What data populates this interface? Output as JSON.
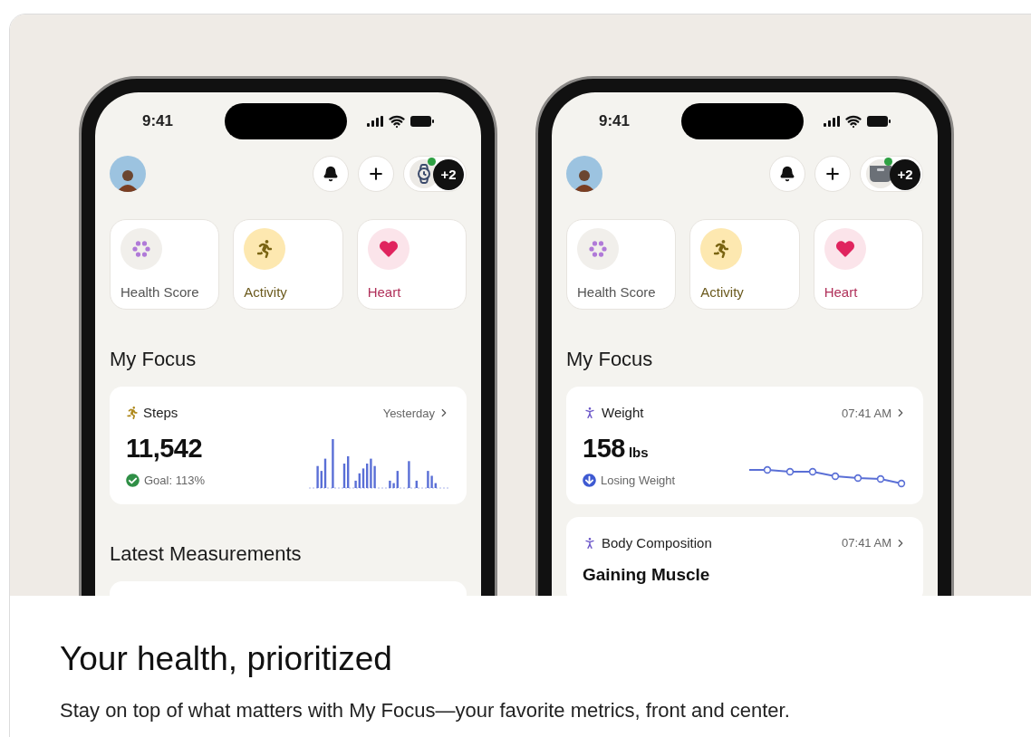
{
  "phones": [
    {
      "status_time": "9:41",
      "device": {
        "kind": "watch",
        "count": "+2",
        "connected": true
      },
      "tiles": [
        {
          "kind": "health_score",
          "label": "Health Score"
        },
        {
          "kind": "activity",
          "label": "Activity"
        },
        {
          "kind": "heart",
          "label": "Heart"
        }
      ],
      "section_title": "My Focus",
      "focus_cards": [
        {
          "kind": "steps",
          "title": "Steps",
          "meta": "Yesterday",
          "value": "11,542",
          "status": "Goal: 113%"
        }
      ],
      "next_section_title": "Latest Measurements"
    },
    {
      "status_time": "9:41",
      "device": {
        "kind": "scale",
        "count": "+2",
        "connected": true
      },
      "tiles": [
        {
          "kind": "health_score",
          "label": "Health Score"
        },
        {
          "kind": "activity",
          "label": "Activity"
        },
        {
          "kind": "heart",
          "label": "Heart"
        }
      ],
      "section_title": "My Focus",
      "focus_cards": [
        {
          "kind": "weight",
          "title": "Weight",
          "meta": "07:41 AM",
          "value": "158",
          "unit": "lbs",
          "status": "Losing Weight"
        },
        {
          "kind": "composition",
          "title": "Body Composition",
          "meta": "07:41 AM",
          "value": "Gaining Muscle"
        }
      ]
    }
  ],
  "headline": "Your health, prioritized",
  "body": "Stay on top of what matters with My Focus—your favorite metrics, front and center."
}
